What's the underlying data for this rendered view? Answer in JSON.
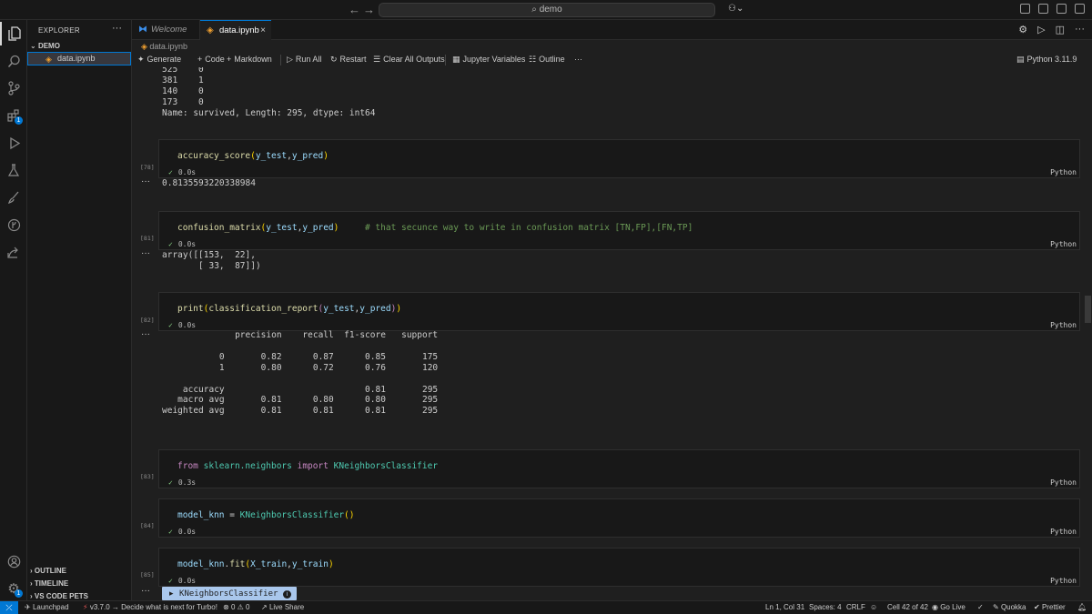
{
  "titlebar": {
    "back": "←",
    "forward": "→",
    "search_text": "demo"
  },
  "sidebar": {
    "header": "EXPLORER",
    "more": "···",
    "folder": "DEMO",
    "file": "data.ipynb",
    "bottom": [
      "OUTLINE",
      "TIMELINE",
      "VS CODE PETS"
    ]
  },
  "activity": {
    "extensions_badge": "1",
    "accounts_badge": "1"
  },
  "tabs": {
    "welcome": "Welcome",
    "active": "data.ipynb",
    "close": "×"
  },
  "breadcrumb": "data.ipynb",
  "toolbar": {
    "generate": "Generate",
    "code": "Code",
    "markdown": "Markdown",
    "run_all": "Run All",
    "restart": "Restart",
    "clear": "Clear All Outputs",
    "variables": "Jupyter Variables",
    "outline": "Outline",
    "more": "···",
    "kernel": "Python 3.11.9"
  },
  "output_top": "525    0\n381    1\n140    0\n173    0\nName: survived, Length: 295, dtype: int64",
  "cells": [
    {
      "exec": "[78]",
      "time": "0.0s",
      "lang": "Python",
      "output": "0.8135593220338984"
    },
    {
      "exec": "[81]",
      "time": "0.0s",
      "lang": "Python",
      "comment": "# that secunce way to write in confusion matrix [TN,FP],[FN,TP]",
      "output": "array([[153,  22],\n       [ 33,  87]])"
    },
    {
      "exec": "[82]",
      "time": "0.0s",
      "lang": "Python",
      "output": "              precision    recall  f1-score   support\n\n           0       0.82      0.87      0.85       175\n           1       0.80      0.72      0.76       120\n\n    accuracy                           0.81       295\n   macro avg       0.81      0.80      0.80       295\nweighted avg       0.81      0.81      0.81       295"
    },
    {
      "exec": "[83]",
      "time": "0.3s",
      "lang": "Python"
    },
    {
      "exec": "[84]",
      "time": "0.0s",
      "lang": "Python"
    },
    {
      "exec": "[85]",
      "time": "0.0s",
      "lang": "Python"
    }
  ],
  "ellipsis": "···",
  "popup": {
    "text": "KNeighborsClassifier",
    "info": "i",
    "help": "?"
  },
  "statusbar": {
    "launchpad": "Launchpad",
    "turbo": "v3.7.0 → Decide what is next for Turbo!",
    "problems": "0",
    "warnings": "0",
    "liveshare": "Live Share",
    "position": "Ln 1, Col 31",
    "spaces": "Spaces: 4",
    "eol": "CRLF",
    "cell": "Cell 42 of 42",
    "golive": "Go Live",
    "quokka": "Quokka",
    "prettier": "Prettier"
  }
}
